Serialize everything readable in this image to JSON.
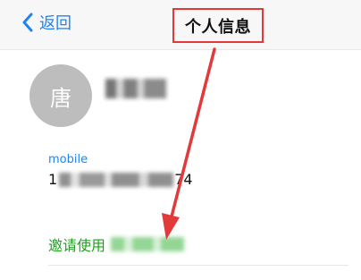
{
  "nav": {
    "back_label": "返回",
    "title": "个人信息"
  },
  "profile": {
    "avatar_text": "唐"
  },
  "contact": {
    "mobile_label": "mobile",
    "mobile_prefix": "1",
    "mobile_suffix": "74"
  },
  "actions": {
    "invite_label": "邀请使用"
  },
  "colors": {
    "accent_blue": "#1f83f2",
    "invite_green": "#18a51b",
    "annotation_red": "#e23a3a",
    "avatar_gray": "#bdbdbd"
  },
  "icons": {
    "back": "chevron-left-icon"
  }
}
